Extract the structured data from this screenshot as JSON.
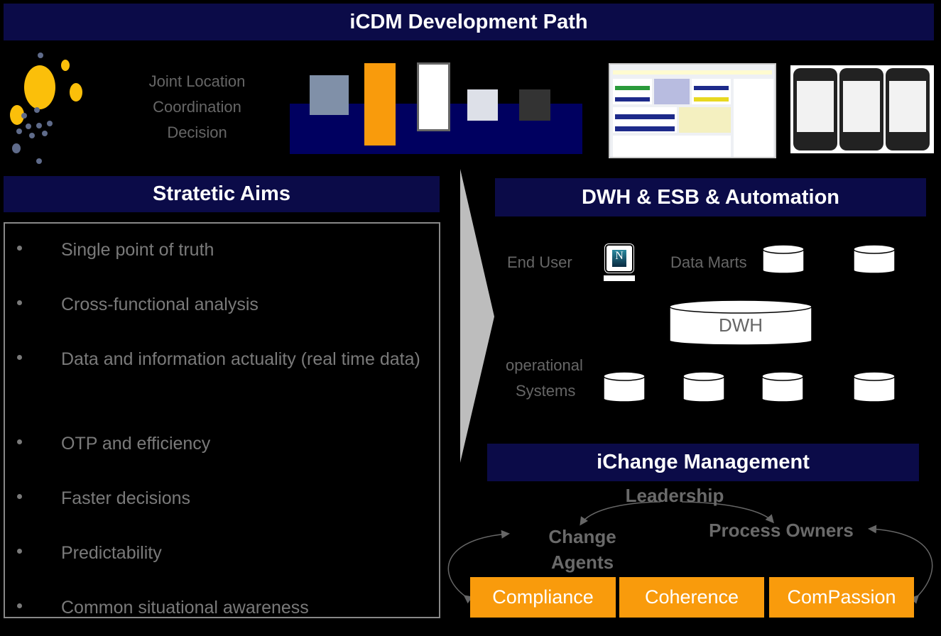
{
  "title": "iCDM Development Path",
  "tagline": [
    "Joint Location",
    "Coordination",
    "Decision"
  ],
  "strategic": {
    "title": "Stratetic Aims",
    "items": [
      "Single point of truth",
      "Cross-functional analysis",
      "Data and information actuality (real time data)",
      "OTP and efficiency",
      "Faster decisions",
      "Predictability",
      "Common situational awareness"
    ]
  },
  "dwh": {
    "title": "DWH & ESB & Automation",
    "end_user": "End User",
    "data_marts": "Data Marts",
    "dwh_label": "DWH",
    "operational": "operational",
    "systems": "Systems"
  },
  "change": {
    "title": "iChange Management",
    "leadership": "Leadership",
    "change_agents": [
      "Change",
      "Agents"
    ],
    "process_owners": "Process Owners",
    "boxes": [
      "Compliance",
      "Coherence",
      "ComPassion"
    ]
  },
  "colors": {
    "navy": "#0b0b48",
    "orange": "#f99b0c",
    "logo_yellow": "#fbbf0a",
    "logo_dots": "#5f6b8a"
  }
}
